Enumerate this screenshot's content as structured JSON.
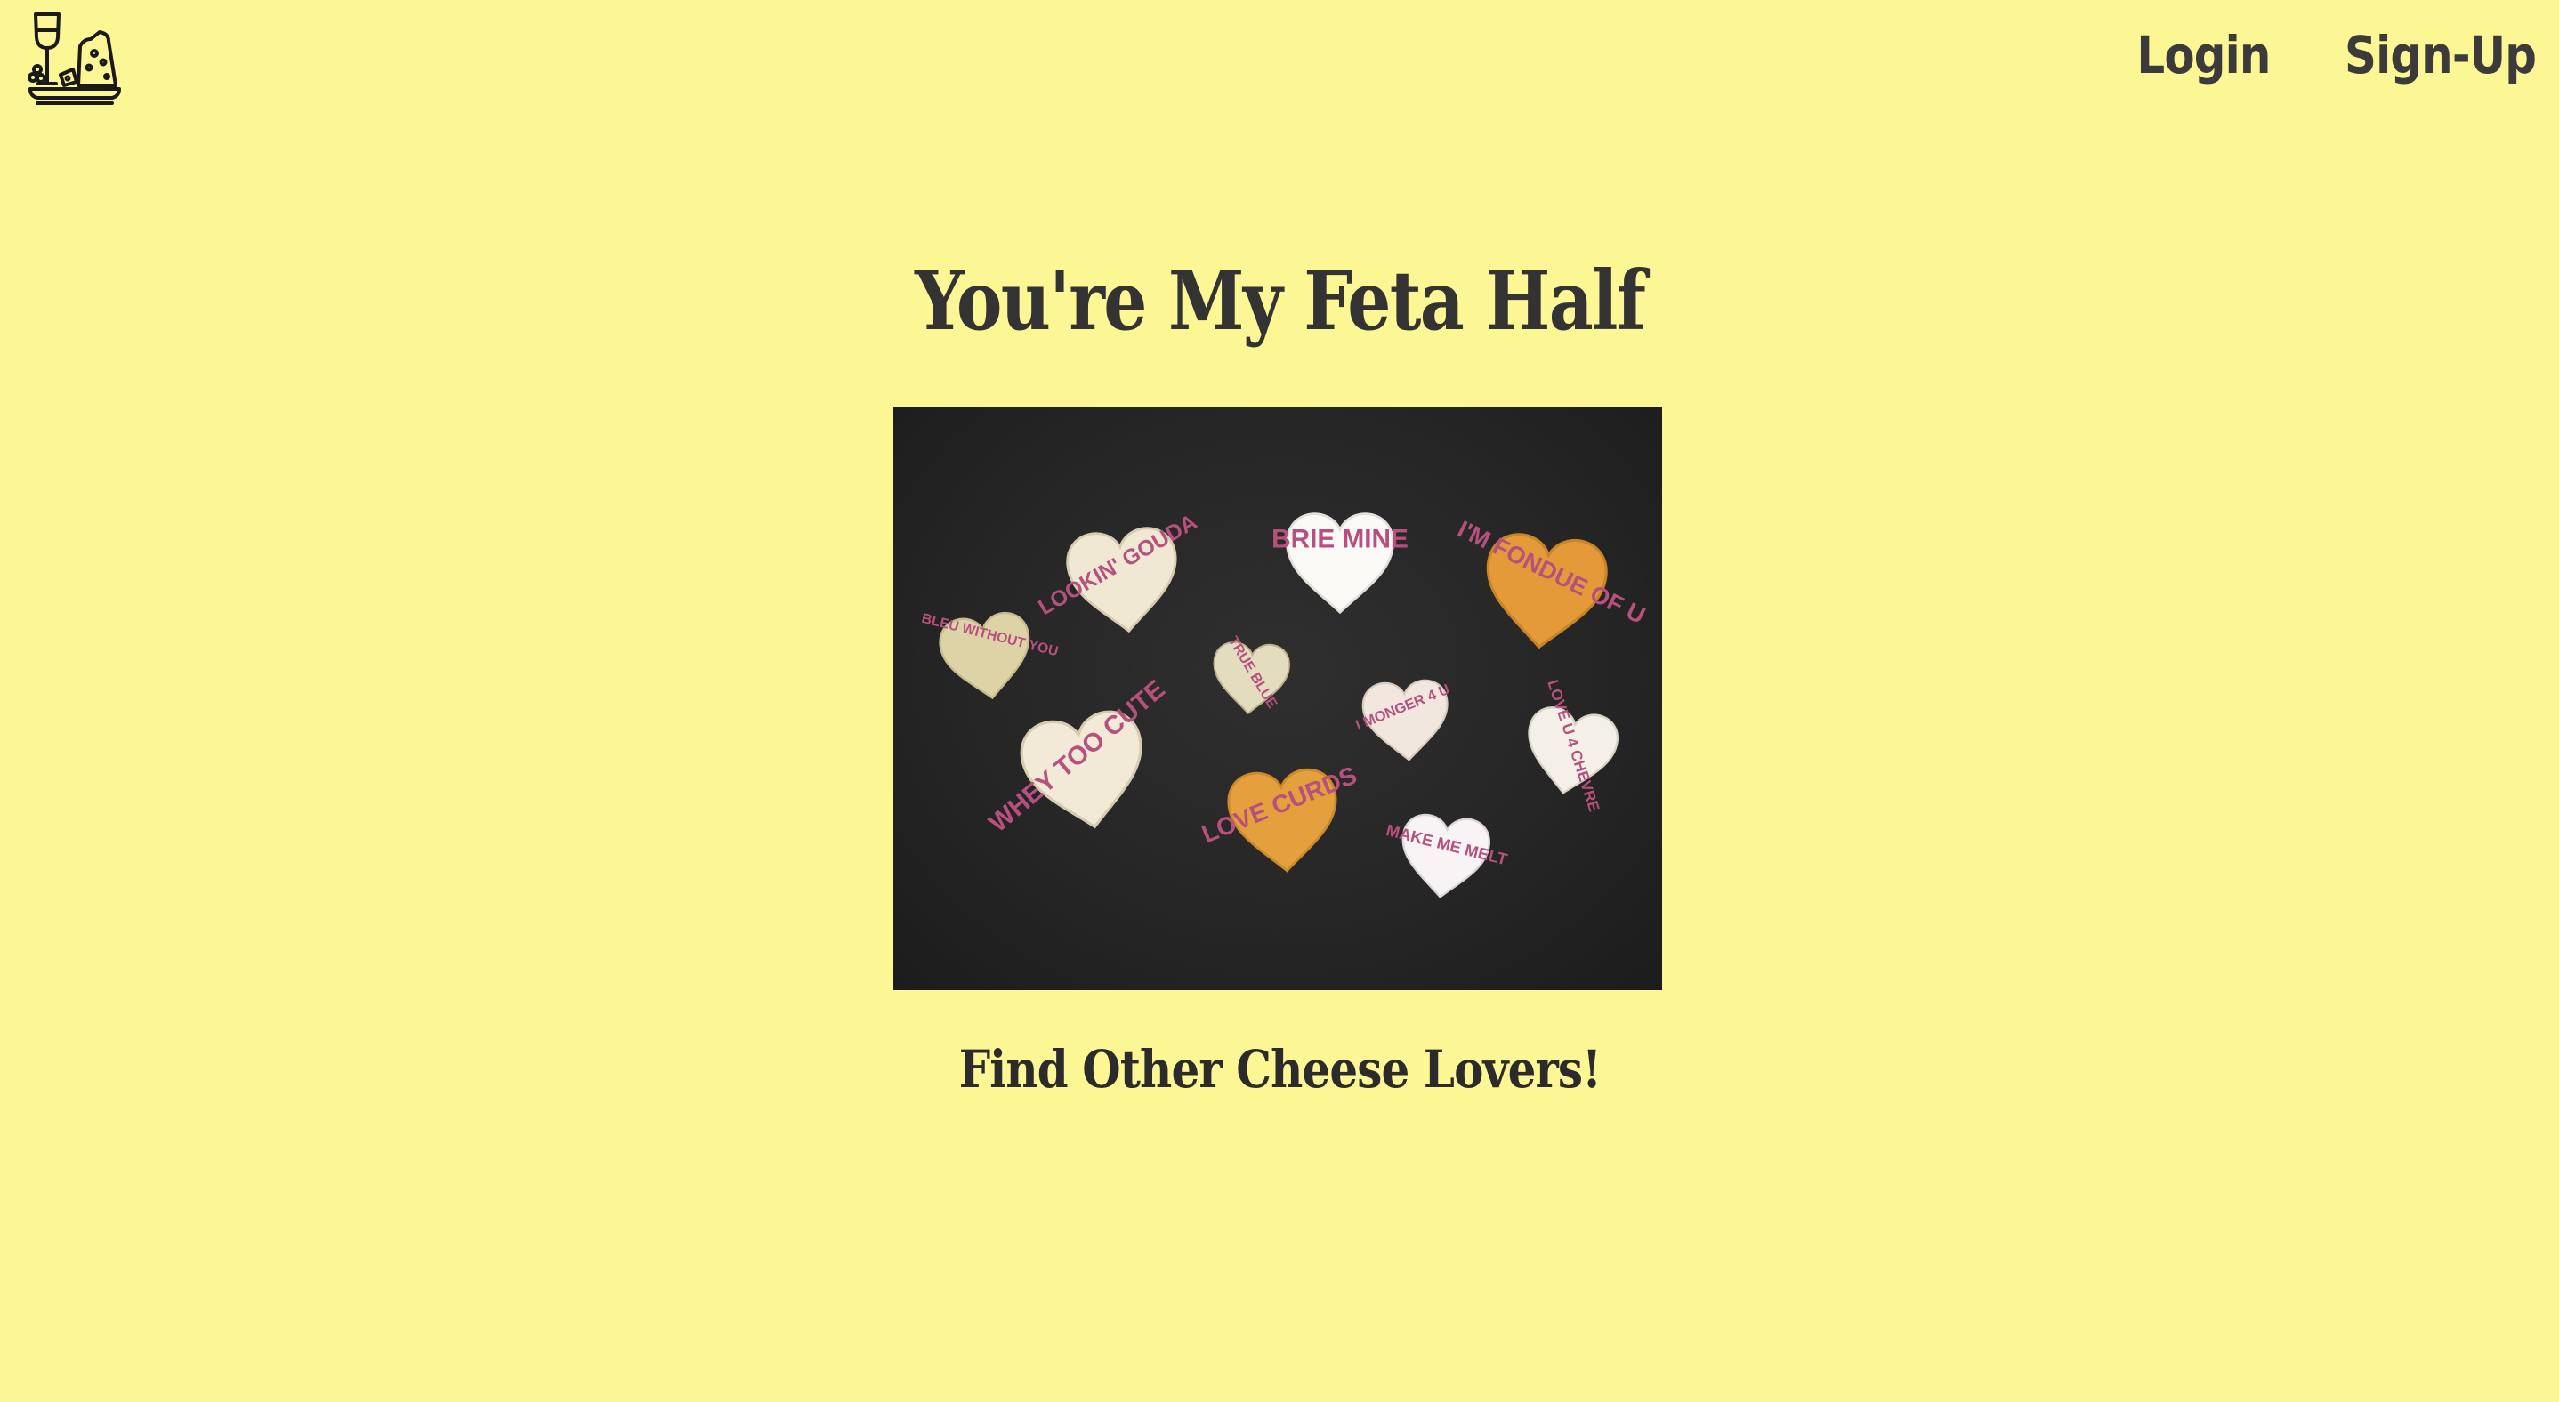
{
  "header": {
    "logo_icon": "wine-and-cheese-board-icon",
    "nav": {
      "login_label": "Login",
      "signup_label": "Sign-Up"
    }
  },
  "hero": {
    "title": "You're My Feta Half",
    "cta": "Find Other Cheese Lovers!"
  },
  "photo": {
    "hearts": [
      {
        "label": "BLEU WITHOUT YOU"
      },
      {
        "label": "LOOKIN' GOUDA"
      },
      {
        "label": "BRIE MINE"
      },
      {
        "label": "I'M FONDUE OF U"
      },
      {
        "label": "TRUE BLUE"
      },
      {
        "label": "I MONGER 4 U"
      },
      {
        "label": "LOVE U 4 CHEVRE"
      },
      {
        "label": "WHEY TOO CUTE"
      },
      {
        "label": "LOVE CURDS"
      },
      {
        "label": "MAKE ME MELT"
      }
    ]
  },
  "colors": {
    "background": "#fdf695",
    "text": "#333333",
    "heart_text": "#b8507f"
  }
}
